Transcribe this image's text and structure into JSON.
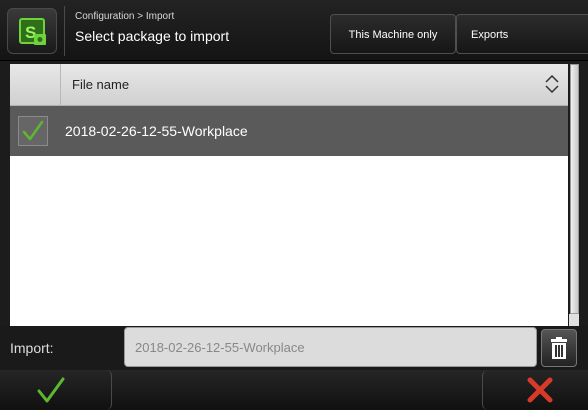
{
  "header": {
    "breadcrumb": "Configuration > Import",
    "title": "Select package to import",
    "logo_icon": "selection-package-icon",
    "buttons": [
      {
        "label": "This Machine only"
      },
      {
        "label": "Exports"
      }
    ]
  },
  "table": {
    "columns": [
      "File name"
    ],
    "rows": [
      {
        "name": "2018-02-26-12-55-Workplace",
        "checked": true
      }
    ]
  },
  "import": {
    "label": "Import:",
    "value": "2018-02-26-12-55-Workplace"
  },
  "footer": {
    "ok_icon": "checkmark-icon",
    "cancel_icon": "close-x-icon"
  },
  "colors": {
    "accent_green": "#5cb82e",
    "cancel_red": "#d83a2a",
    "selected_row": "#5a5a5a"
  }
}
